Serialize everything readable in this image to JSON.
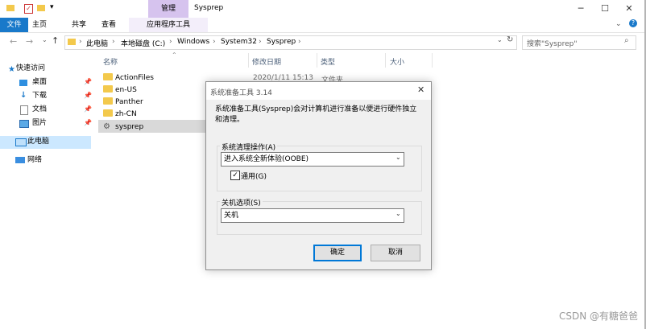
{
  "window": {
    "title": "Sysprep",
    "context_tab": "管理",
    "buttons": {
      "minimize": "─",
      "maximize": "☐",
      "close": "✕"
    }
  },
  "ribbon": {
    "tabs": [
      "文件",
      "主页",
      "共享",
      "查看",
      "应用程序工具"
    ],
    "active_tab_color": "#1979ca"
  },
  "address": {
    "crumbs": [
      "此电脑",
      "本地磁盘 (C:)",
      "Windows",
      "System32",
      "Sysprep"
    ],
    "search_placeholder": "搜索\"Sysprep\""
  },
  "nav": {
    "quick_access": "快速访问",
    "items": [
      "桌面",
      "下载",
      "文档",
      "图片"
    ],
    "this_pc": "此电脑",
    "network": "网络"
  },
  "columns": {
    "name": "名称",
    "modified": "修改日期",
    "type": "类型",
    "size": "大小"
  },
  "files": [
    {
      "name": "ActionFiles",
      "modified": "2020/1/11 15:13",
      "type": "文件夹"
    },
    {
      "name": "en-US"
    },
    {
      "name": "Panther"
    },
    {
      "name": "zh-CN"
    },
    {
      "name": "sysprep"
    }
  ],
  "dialog": {
    "title": "系统准备工具 3.14",
    "description": "系统准备工具(Sysprep)会对计算机进行准备以便进行硬件独立和清理。",
    "cleanup_label": "系统清理操作(A)",
    "cleanup_value": "进入系统全新体验(OOBE)",
    "generalize_label": "通用(G)",
    "generalize_checked": true,
    "shutdown_label": "关机选项(S)",
    "shutdown_value": "关机",
    "ok": "确定",
    "cancel": "取消"
  },
  "watermark": "CSDN @有糖爸爸"
}
